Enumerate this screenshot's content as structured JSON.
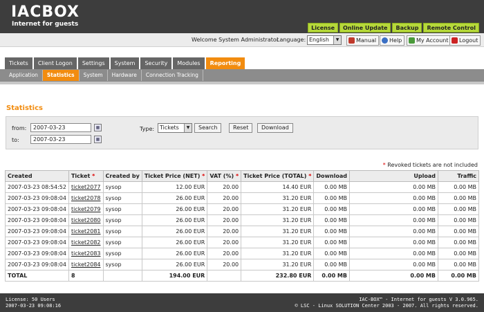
{
  "brand": {
    "logo_a": "IAC",
    "logo_b": "BOX",
    "tagline": "Internet for guests"
  },
  "top_menu": [
    "License",
    "Online Update",
    "Backup",
    "Remote Control"
  ],
  "userbar": {
    "welcome": "Welcome System Administrator",
    "language_label": "Language:",
    "language_value": "English",
    "buttons": [
      "Manual",
      "Help",
      "My Account",
      "Logout"
    ]
  },
  "tabs": [
    "Tickets",
    "Client Logon",
    "Settings",
    "System",
    "Security",
    "Modules",
    "Reporting"
  ],
  "subtabs": [
    "Application",
    "Statistics",
    "System",
    "Hardware",
    "Connection Tracking"
  ],
  "page_title": "Statistics",
  "filter": {
    "from_label": "from:",
    "from_value": "2007-03-23",
    "to_label": "to:",
    "to_value": "2007-03-23",
    "type_label": "Type:",
    "type_value": "Tickets",
    "search": "Search",
    "reset": "Reset",
    "download": "Download"
  },
  "note": {
    "star": "*",
    "text": " Revoked tickets are not included"
  },
  "table": {
    "headers": [
      "Created",
      "Ticket",
      "Created by",
      "Ticket Price (NET)",
      "VAT (%)",
      "Ticket Price (TOTAL)",
      "Download",
      "Upload",
      "Traffic"
    ],
    "rows": [
      [
        "2007-03-23 08:54:52",
        "ticket2077",
        "sysop",
        "12.00 EUR",
        "20.00",
        "14.40 EUR",
        "0.00 MB",
        "0.00 MB",
        "0.00 MB"
      ],
      [
        "2007-03-23 09:08:04",
        "ticket2078",
        "sysop",
        "26.00 EUR",
        "20.00",
        "31.20 EUR",
        "0.00 MB",
        "0.00 MB",
        "0.00 MB"
      ],
      [
        "2007-03-23 09:08:04",
        "ticket2079",
        "sysop",
        "26.00 EUR",
        "20.00",
        "31.20 EUR",
        "0.00 MB",
        "0.00 MB",
        "0.00 MB"
      ],
      [
        "2007-03-23 09:08:04",
        "ticket2080",
        "sysop",
        "26.00 EUR",
        "20.00",
        "31.20 EUR",
        "0.00 MB",
        "0.00 MB",
        "0.00 MB"
      ],
      [
        "2007-03-23 09:08:04",
        "ticket2081",
        "sysop",
        "26.00 EUR",
        "20.00",
        "31.20 EUR",
        "0.00 MB",
        "0.00 MB",
        "0.00 MB"
      ],
      [
        "2007-03-23 09:08:04",
        "ticket2082",
        "sysop",
        "26.00 EUR",
        "20.00",
        "31.20 EUR",
        "0.00 MB",
        "0.00 MB",
        "0.00 MB"
      ],
      [
        "2007-03-23 09:08:04",
        "ticket2083",
        "sysop",
        "26.00 EUR",
        "20.00",
        "31.20 EUR",
        "0.00 MB",
        "0.00 MB",
        "0.00 MB"
      ],
      [
        "2007-03-23 09:08:04",
        "ticket2084",
        "sysop",
        "26.00 EUR",
        "20.00",
        "31.20 EUR",
        "0.00 MB",
        "0.00 MB",
        "0.00 MB"
      ]
    ],
    "total": [
      "TOTAL",
      "8",
      "",
      "194.00 EUR",
      "",
      "232.80 EUR",
      "0.00 MB",
      "0.00 MB",
      "0.00 MB"
    ]
  },
  "footer": {
    "license": "License: 50 Users",
    "datetime": "2007-03-23 09:08:16",
    "product": "IAC-BOX™ - Internet for guests V 3.0.965.",
    "copyright": "© LSC - Linux SOLUTION Center 2003 - 2007. All rights reserved."
  },
  "colors": {
    "accent": "#f28c0f",
    "top_menu": "#b6d93a",
    "header_bg": "#3d3d3d"
  }
}
